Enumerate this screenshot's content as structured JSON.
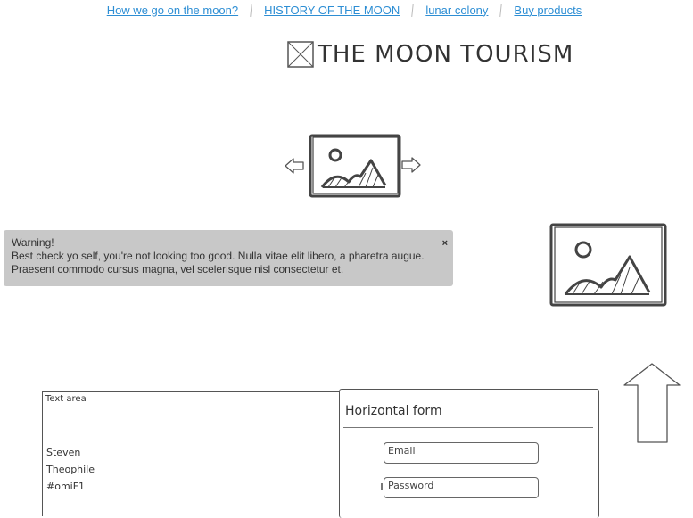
{
  "nav": {
    "links": [
      "How we go on the moon?",
      "HISTORY OF THE MOON",
      "lunar colony",
      "Buy products"
    ]
  },
  "logo": {
    "text": "THE MOON TOURISM",
    "icon": "image-placeholder-icon"
  },
  "carousel": {
    "image_icon": "image-placeholder-icon",
    "prev_icon": "arrow-left-icon",
    "next_icon": "arrow-right-icon"
  },
  "side_image": {
    "icon": "image-placeholder-icon"
  },
  "alert": {
    "title": "Warning!",
    "message": "Best check yo self, you're not looking too good. Nulla vitae elit libero, a pharetra augue. Praesent commodo cursus magna, vel scelerisque nisl consectetur et.",
    "close_label": "×"
  },
  "scroll_up": {
    "icon": "arrow-up-icon"
  },
  "textarea": {
    "label": "Text area",
    "lines": [
      "Steven",
      "Theophile",
      "#omiF1"
    ]
  },
  "form": {
    "title": "Horizontal form",
    "email_placeholder": "Email",
    "password_placeholder": "Password"
  },
  "colors": {
    "link": "#2d8ed4",
    "alert_bg": "#c8c8c8",
    "sketch": "#444444"
  }
}
